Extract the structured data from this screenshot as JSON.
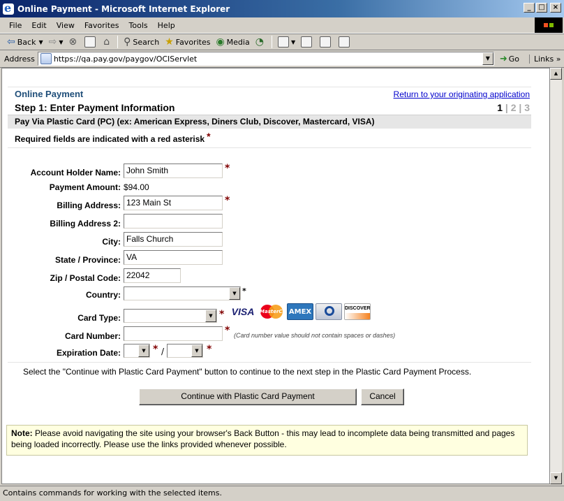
{
  "window": {
    "title": "Online Payment - Microsoft Internet Explorer",
    "min_glyph": "_",
    "max_glyph": "□",
    "close_glyph": "×"
  },
  "menu": {
    "items": [
      "File",
      "Edit",
      "View",
      "Favorites",
      "Tools",
      "Help"
    ]
  },
  "toolbar": {
    "back": "Back",
    "search": "Search",
    "favorites": "Favorites",
    "media": "Media"
  },
  "address": {
    "label": "Address",
    "url": "https://qa.pay.gov/paygov/OCIServlet",
    "go": "Go",
    "links": "Links",
    "links_more": "»"
  },
  "page": {
    "app_title": "Online Payment",
    "return_link": "Return to your originating application",
    "step_title": "Step 1: Enter Payment Information",
    "steps": {
      "current": "1",
      "sep1": "|",
      "s2": "2",
      "sep2": "|",
      "s3": "3"
    },
    "sub_heading": "Pay Via Plastic Card (PC) (ex: American Express, Diners Club, Discover, Mastercard, VISA)",
    "required_note": "Required fields are indicated with a red asterisk",
    "asterisk": "*"
  },
  "form": {
    "account_holder": {
      "label": "Account Holder Name:",
      "value": "John Smith"
    },
    "payment_amount": {
      "label": "Payment Amount:",
      "value": "$94.00"
    },
    "billing_address": {
      "label": "Billing Address:",
      "value": "123 Main St"
    },
    "billing_address2": {
      "label": "Billing Address 2:",
      "value": ""
    },
    "city": {
      "label": "City:",
      "value": "Falls Church"
    },
    "state": {
      "label": "State / Province:",
      "value": "VA"
    },
    "zip": {
      "label": "Zip / Postal Code:",
      "value": "22042"
    },
    "country": {
      "label": "Country:",
      "value": ""
    },
    "card_type": {
      "label": "Card Type:",
      "value": ""
    },
    "card_number": {
      "label": "Card Number:",
      "value": "",
      "hint": "(Card number value should not contain spaces or dashes)"
    },
    "expiration": {
      "label": "Expiration Date:",
      "month": "",
      "year": "",
      "separator": "/"
    },
    "card_logos": [
      "VISA",
      "MasterCard",
      "AMEX",
      "Diners Club",
      "DISCOVER"
    ]
  },
  "actions": {
    "instruction": "Select the \"Continue with Plastic Card Payment\" button to continue to the next step in the Plastic Card Payment Process.",
    "continue_label": "Continue with Plastic Card Payment",
    "cancel_label": "Cancel"
  },
  "note": {
    "prefix": "Note:",
    "text": " Please avoid navigating the site using your browser's Back Button - this may lead to incomplete data being transmitted and pages being loaded incorrectly. Please use the links provided whenever possible."
  },
  "status": {
    "text": "Contains commands for working with the selected items."
  }
}
